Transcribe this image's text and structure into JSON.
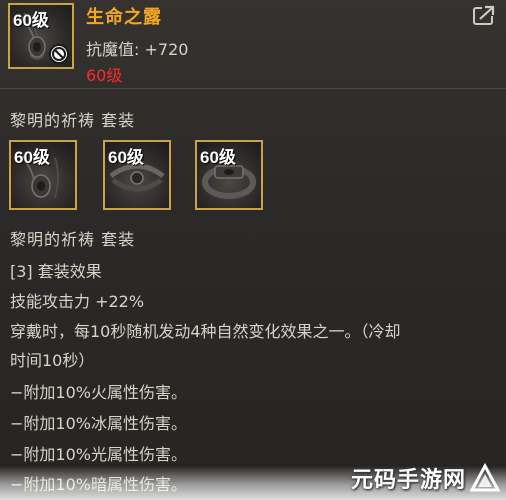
{
  "item": {
    "level_badge": "60级",
    "name": "生命之露",
    "stat": "抗魔值: +720",
    "required_level": "60级",
    "icon": "amulet-icon",
    "restriction_icon": "forbidden-icon",
    "share_icon": "share-export-icon"
  },
  "set": {
    "title_top": "黎明的祈祷  套装",
    "pieces": [
      {
        "level": "60级",
        "icon": "necklace-icon"
      },
      {
        "level": "60级",
        "icon": "bracelet-icon"
      },
      {
        "level": "60级",
        "icon": "ring-icon"
      }
    ],
    "title_bottom": "黎明的祈祷  套装",
    "effects": [
      "[3] 套装效果",
      "技能攻击力 +22%",
      "穿戴时，每10秒随机发动4种自然变化效果之一。（冷却",
      "时间10秒）",
      "−附加10%火属性伤害。",
      "−附加10%冰属性伤害。",
      "−附加10%光属性伤害。",
      "−附加10%暗属性伤害。"
    ]
  },
  "watermark": {
    "text": "元码手游网",
    "logo": "triangle-logo-icon"
  },
  "colors": {
    "item_name": "#f5a623",
    "required_level": "#ff2a2a",
    "frame_gold": "#c9a24a",
    "text": "#d8d3c8",
    "background": "#2d2b29"
  }
}
